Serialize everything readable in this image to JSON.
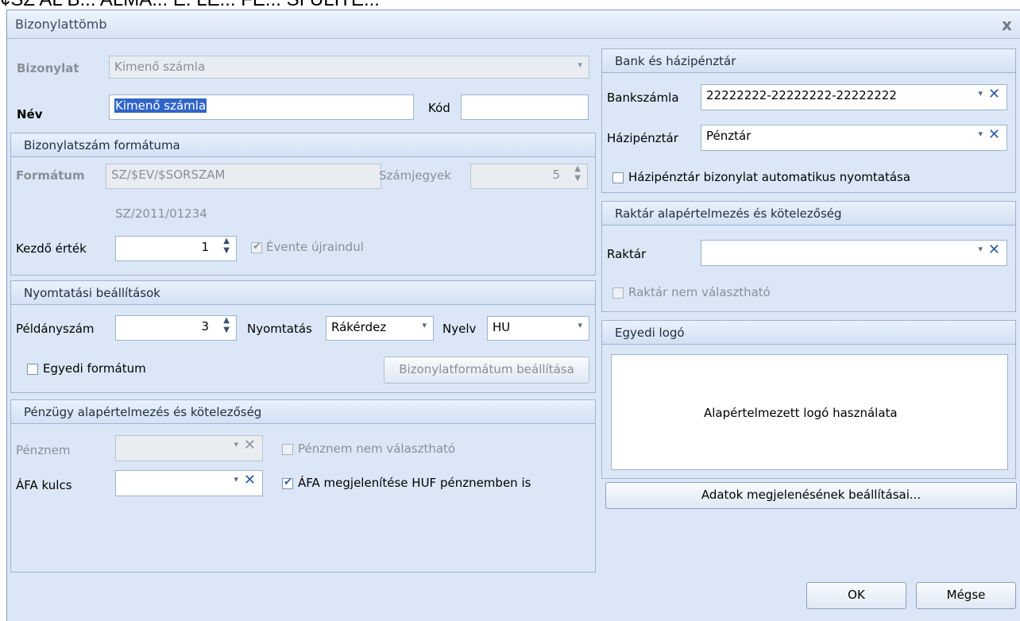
{
  "top_clip_text": "¢SZ AL B... ALMA... E. LE... FE... SI ÜLÍTE...",
  "window": {
    "title": "Bizonylattömb",
    "close": "x"
  },
  "bizonylat": {
    "label": "Bizonylat",
    "value": "Kimenő számla"
  },
  "nev": {
    "label": "Név",
    "value": "Kimenő számla"
  },
  "kod": {
    "label": "Kód",
    "value": ""
  },
  "format_panel": {
    "title": "Bizonylatszám formátuma",
    "format_label": "Formátum",
    "format_value": "SZ/$EV/$SORSZAM",
    "digits_label": "Számjegyek",
    "digits_value": "5",
    "preview": "SZ/2011/01234",
    "start_label": "Kezdő érték",
    "start_value": "1",
    "yearly_reset_label": "Évente újraindul",
    "yearly_reset_checked": true
  },
  "print_panel": {
    "title": "Nyomtatási beállítások",
    "copies_label": "Példányszám",
    "copies_value": "3",
    "print_label": "Nyomtatás",
    "print_value": "Rákérdez",
    "lang_label": "Nyelv",
    "lang_value": "HU",
    "custom_format_label": "Egyedi formátum",
    "custom_format_checked": false,
    "format_settings_button": "Bizonylatformátum beállítása"
  },
  "finance_panel": {
    "title": "Pénzügy alapértelmezés és kötelezőség",
    "currency_label": "Pénznem",
    "currency_value": "",
    "currency_lock_label": "Pénznem nem választható",
    "currency_lock_checked": false,
    "vat_label": "ÁFA kulcs",
    "vat_value": "",
    "vat_huf_label": "ÁFA megjelenítése HUF pénznemben is",
    "vat_huf_checked": true
  },
  "bank_panel": {
    "title": "Bank és házipénztár",
    "account_label": "Bankszámla",
    "account_value": "22222222-22222222-22222222",
    "cashbox_label": "Házipénztár",
    "cashbox_value": "Pénztár",
    "auto_print_label": "Házipénztár bizonylat automatikus nyomtatása",
    "auto_print_checked": false
  },
  "stock_panel": {
    "title": "Raktár alapértelmezés és kötelezőség",
    "stock_label": "Raktár",
    "stock_value": "",
    "stock_lock_label": "Raktár nem választható",
    "stock_lock_checked": false
  },
  "logo_panel": {
    "title": "Egyedi logó",
    "placeholder": "Alapértelmezett logó használata"
  },
  "buttons": {
    "display_settings": "Adatok megjelenésének beállításai...",
    "ok": "OK",
    "cancel": "Mégse"
  },
  "icons": {
    "dropdown": "chevron-down-icon",
    "clear": "clear-x-icon",
    "spinner": "spinner-arrows-icon",
    "check": "checkmark-icon"
  }
}
